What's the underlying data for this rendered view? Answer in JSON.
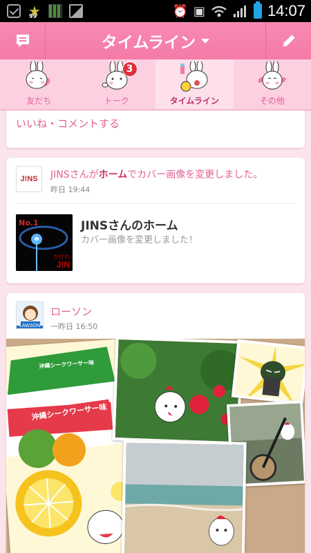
{
  "status_bar": {
    "time": "14:07",
    "badge_number": "99"
  },
  "header": {
    "title": "タイムライン",
    "left_icon": "message-icon",
    "right_icon": "pencil-icon"
  },
  "tabs": [
    {
      "label": "友だち",
      "icon": "bunny-heart-icon"
    },
    {
      "label": "トーク",
      "icon": "bunny-talk-icon",
      "badge": "3"
    },
    {
      "label": "タイムライン",
      "icon": "bunny-timeline-icon",
      "active": true
    },
    {
      "label": "その他",
      "icon": "bunny-other-icon"
    }
  ],
  "feed": {
    "like_comment": "いいね・コメントする",
    "post1": {
      "avatar_text": "J!NS",
      "line_prefix": "JINSさんが",
      "line_bold": "ホーム",
      "line_suffix": "でカバー画像を変更しました。",
      "time": "昨日 19:44",
      "attachment_title": "JINSさんのホーム",
      "attachment_sub": "カバー画像を変更しました！",
      "thumb_text_top": "No.1",
      "thumb_text_mid": "かけれ",
      "thumb_text_bot": "J!N"
    },
    "post2": {
      "name": "ローソン",
      "time": "一昨日 16:50",
      "avatar_text": "LAWSON",
      "package_text": "沖縄シークワーサー味",
      "package_text_small": "沖縄シークワーサー味"
    }
  },
  "colors": {
    "accent": "#f57aa8",
    "tab_bg": "#fcd0e0",
    "feed_bg": "#fbe4ec",
    "link_pink": "#e45f95"
  }
}
